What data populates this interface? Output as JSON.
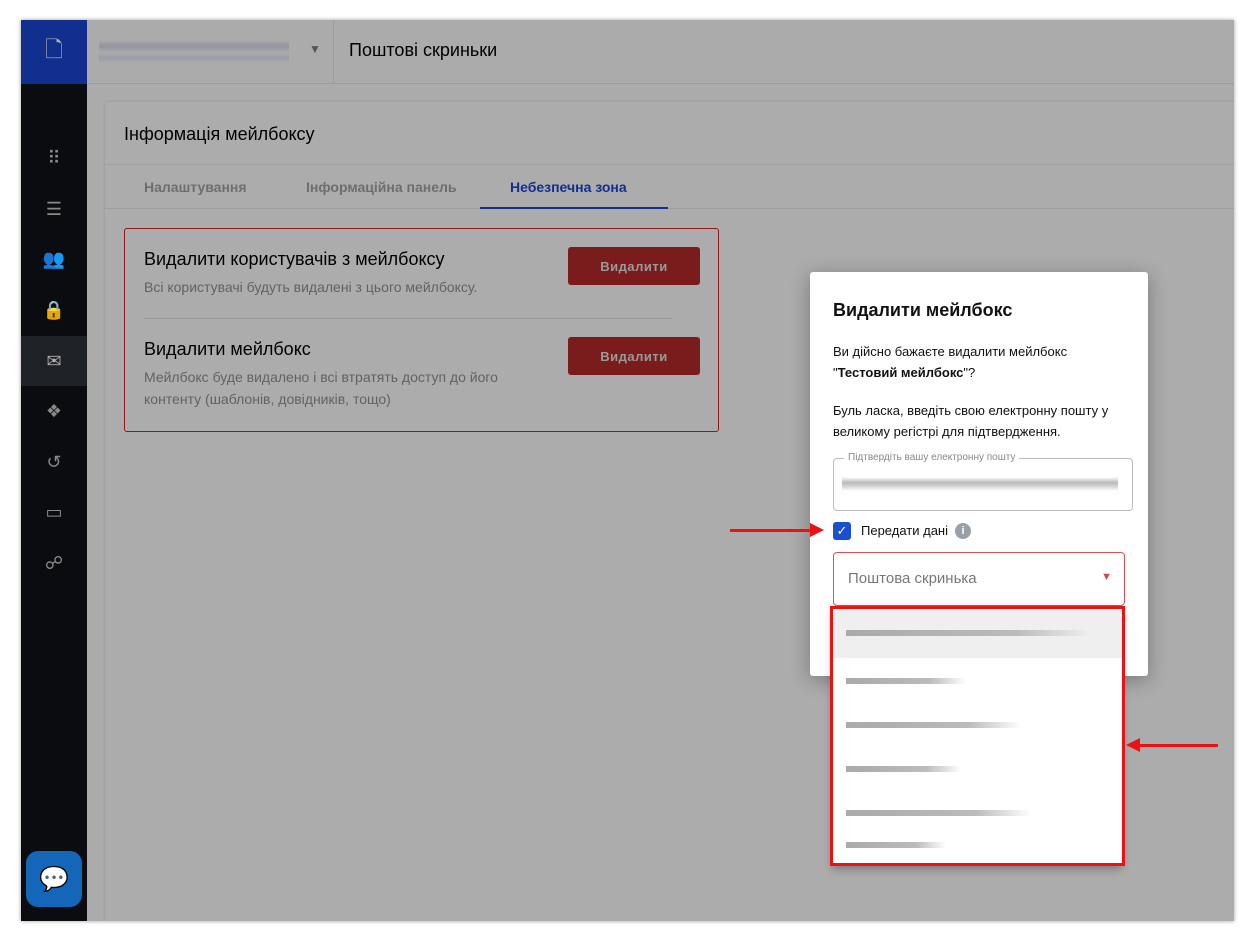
{
  "header": {
    "title": "Поштові скриньки"
  },
  "card": {
    "title": "Інформація мейлбоксу",
    "tabs": [
      {
        "label": "Налаштування"
      },
      {
        "label": "Інформаційна панель"
      },
      {
        "label": "Небезпечна зона",
        "active": true
      }
    ]
  },
  "danger": {
    "items": [
      {
        "title": "Видалити користувачів з мейлбоксу",
        "description": "Всі користувачі будуть видалені з цього мейлбоксу.",
        "button": "Видалити"
      },
      {
        "title": "Видалити мейлбокс",
        "description": "Мейлбокс буде видалено і всі втратять доступ до його контенту (шаблонів, довідників, тощо)",
        "button": "Видалити"
      }
    ]
  },
  "dialog": {
    "title": "Видалити мейлбокс",
    "question": "Ви дійсно бажаєте видалити мейлбокс",
    "mailbox_name": "Тестовий мейлбокс",
    "instruction": "Буль ласка, введіть свою електронну пошту у великому регістрі для підтвердження.",
    "email_label": "Підтвердіть вашу електронну пошту",
    "transfer_label": "Передати дані",
    "transfer_checked": true,
    "select_placeholder": "Поштова скринька"
  },
  "colors": {
    "accent": "#1a4fd0",
    "danger": "#c0392b",
    "annotation": "#ee1111"
  }
}
